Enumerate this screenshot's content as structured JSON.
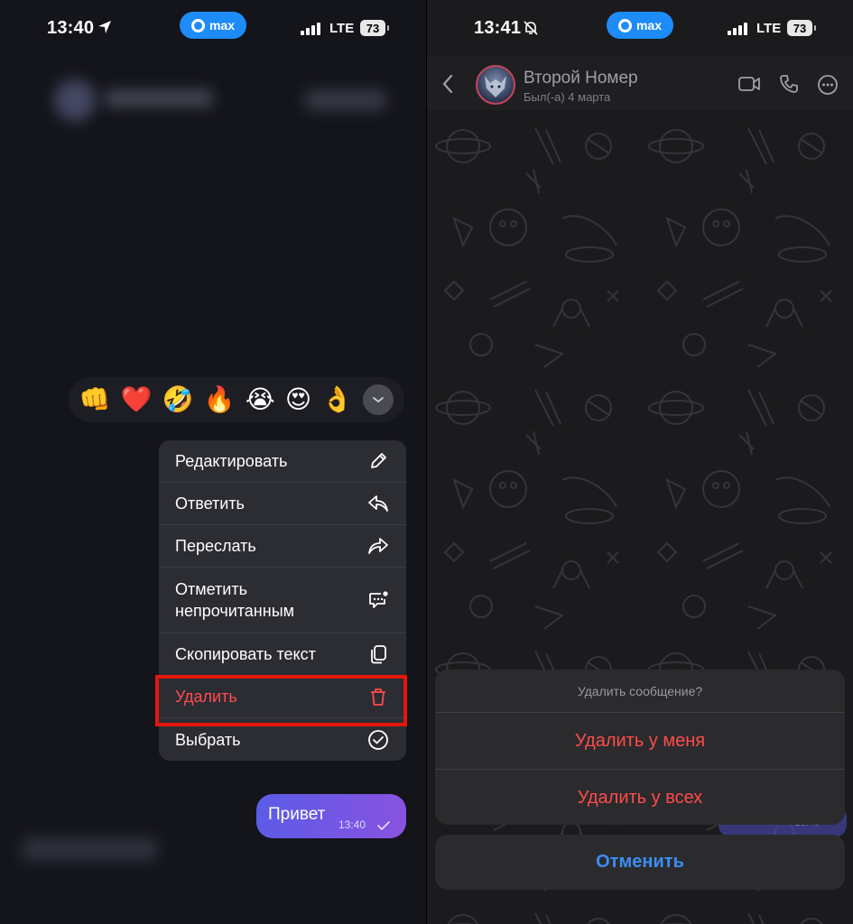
{
  "left": {
    "status": {
      "time": "13:40",
      "app_pill": "max",
      "network": "LTE",
      "battery": "73"
    },
    "reactions": [
      "👊",
      "❤️",
      "🤣",
      "🔥",
      "😭",
      "😍",
      "👌"
    ],
    "menu": {
      "items": [
        {
          "label": "Редактировать",
          "icon": "pencil-icon"
        },
        {
          "label": "Ответить",
          "icon": "reply-icon"
        },
        {
          "label": "Переслать",
          "icon": "forward-icon"
        },
        {
          "label": "Отметить непрочитанным",
          "icon": "unread-icon"
        },
        {
          "label": "Скопировать текст",
          "icon": "copy-icon"
        },
        {
          "label": "Удалить",
          "icon": "trash-icon"
        },
        {
          "label": "Выбрать",
          "icon": "check-circle-icon"
        }
      ]
    },
    "message": {
      "text": "Привет",
      "time": "13:40"
    }
  },
  "right": {
    "status": {
      "time": "13:41",
      "app_pill": "max",
      "network": "LTE",
      "battery": "73"
    },
    "header": {
      "name": "Второй Номер",
      "last_seen": "Был(-а) 4 марта"
    },
    "sheet": {
      "question": "Удалить сообщение?",
      "delete_for_me": "Удалить у меня",
      "delete_for_all": "Удалить у всех",
      "cancel": "Отменить"
    },
    "peek_time": "13:40"
  },
  "colors": {
    "accent": "#3d8df2",
    "danger": "#ff4b4b",
    "highlight": "#e5160a",
    "bubble_start": "#5a5ce8",
    "bubble_end": "#8a52e0"
  }
}
